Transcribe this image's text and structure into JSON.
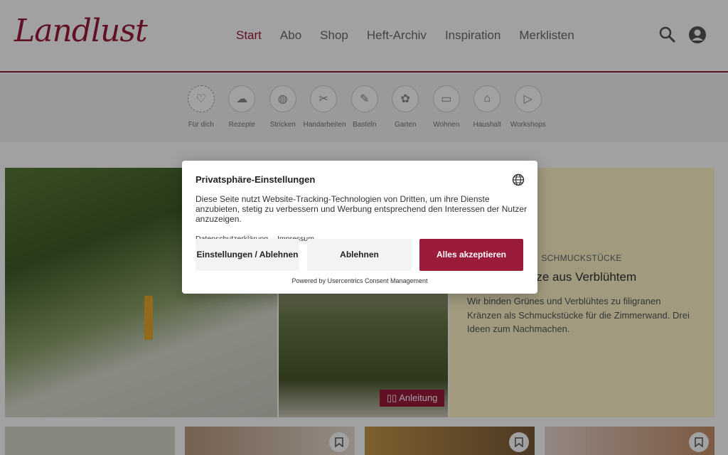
{
  "header": {
    "logo_text": "Landlust",
    "nav": [
      "Start",
      "Abo",
      "Shop",
      "Heft-Archiv",
      "Inspiration",
      "Merklisten"
    ],
    "active_nav": "Start"
  },
  "categories": [
    {
      "label": "Für dich",
      "icon": "heart-icon",
      "glyph": "♡"
    },
    {
      "label": "Rezepte",
      "icon": "chef-hat-icon",
      "glyph": "☁"
    },
    {
      "label": "Stricken",
      "icon": "yarn-icon",
      "glyph": "◍"
    },
    {
      "label": "Handarbeiten",
      "icon": "scissors-icon",
      "glyph": "✂"
    },
    {
      "label": "Basteln",
      "icon": "craft-icon",
      "glyph": "✎"
    },
    {
      "label": "Garten",
      "icon": "plant-icon",
      "glyph": "✿"
    },
    {
      "label": "Wohnen",
      "icon": "sofa-icon",
      "glyph": "▭"
    },
    {
      "label": "Haushalt",
      "icon": "household-icon",
      "glyph": "⌂"
    },
    {
      "label": "Workshops",
      "icon": "play-icon",
      "glyph": "▷"
    }
  ],
  "hero": {
    "kicker": "SCHMUCKSTÜCKE",
    "title": "n Herbstkränze aus Verblühtem",
    "description": "Wir binden Grünes und Verblühtes zu filigranen Kränzen als Schmuckstücke für die Zimmerwand. Drei Ideen zum Nachmachen.",
    "tag": "Anleitung"
  },
  "consent": {
    "title": "Privatsphäre-Einstellungen",
    "body": "Diese Seite nutzt Website-Tracking-Technologien von Dritten, um ihre Dienste anzubieten, stetig zu verbessern und Werbung entsprechend den Interessen der Nutzer anzuzeigen.",
    "links": [
      "Datenschutzerklärung",
      "Impressum"
    ],
    "btn_settings": "Einstellungen / Ablehnen",
    "btn_decline": "Ablehnen",
    "btn_accept": "Alles akzeptieren",
    "powered_by": "Powered by Usercentrics Consent Management"
  },
  "colors": {
    "brand": "#9b1c3a",
    "hero_text_bg": "#fff4c9"
  }
}
